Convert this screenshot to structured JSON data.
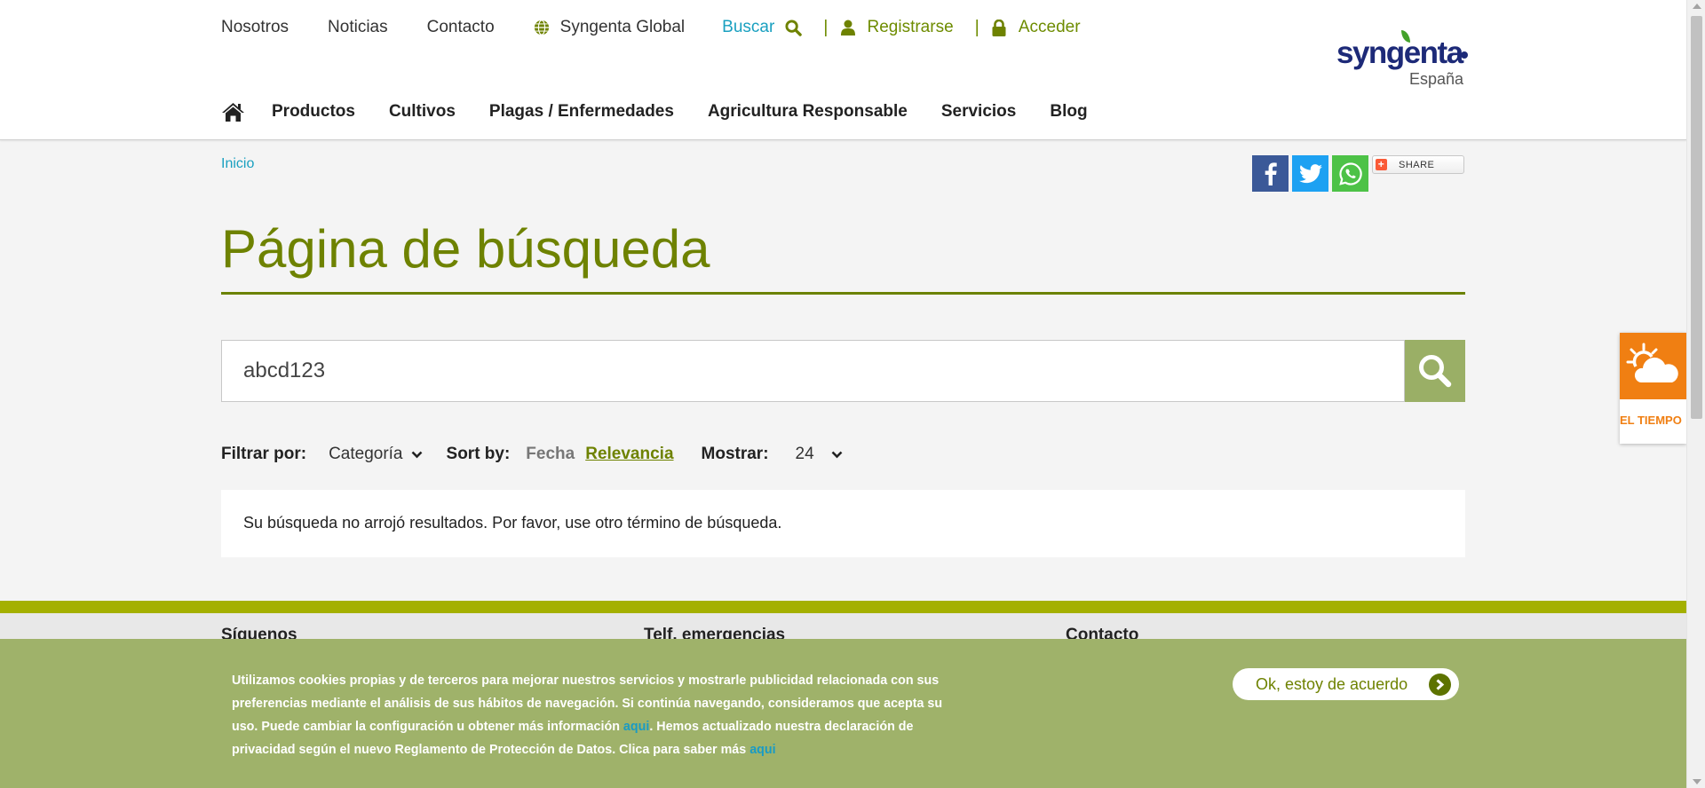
{
  "colors": {
    "brand_green": "#6e8200",
    "link_blue": "#1aa0c0",
    "search_button": "#9aaf66",
    "footer_band": "#a4b000",
    "cookie_bg": "#9fb26a",
    "weather_orange": "#f07f12",
    "logo_navy": "#1d2a78"
  },
  "topnav": {
    "nosotros": "Nosotros",
    "noticias": "Noticias",
    "contacto": "Contacto",
    "global": "Syngenta Global",
    "buscar": "Buscar",
    "registrarse": "Registrarse",
    "acceder": "Acceder",
    "separator": "|"
  },
  "logo": {
    "word": "syngenta",
    "country": "España"
  },
  "mainnav": {
    "items": [
      "Productos",
      "Cultivos",
      "Plagas / Enfermedades",
      "Agricultura Responsable",
      "Servicios",
      "Blog"
    ]
  },
  "breadcrumb": {
    "home": "Inicio"
  },
  "share": {
    "share_label": "SHARE",
    "plus": "+"
  },
  "page": {
    "title": "Página de búsqueda"
  },
  "search": {
    "value": "abcd123"
  },
  "filters": {
    "filter_label": "Filtrar por:",
    "category": "Categoría",
    "sort_label": "Sort by:",
    "sort_date": "Fecha",
    "sort_relevance": "Relevancia",
    "show_label": "Mostrar:",
    "show_value": "24"
  },
  "results": {
    "message": "Su búsqueda no arrojó resultados. Por favor, use otro término de búsqueda."
  },
  "footer": {
    "col1": "Síguenos",
    "col2": "Telf. emergencias",
    "col3": "Contacto"
  },
  "cookie": {
    "text_part1": "Utilizamos cookies propias y de terceros para mejorar nuestros servicios y mostrarle publicidad relacionada con sus preferencias mediante el análisis de sus hábitos de navegación. Si continúa navegando, consideramos que acepta su uso. Puede cambiar la configuración u obtener más información ",
    "link1": "aqui",
    "text_part2": ". Hemos actualizado nuestra declaración de privacidad según el nuevo Reglamento de Protección de Datos. Clica para saber más ",
    "link2": "aqui",
    "ok_button": "Ok, estoy de acuerdo"
  },
  "weather": {
    "label": "EL TIEMPO"
  }
}
